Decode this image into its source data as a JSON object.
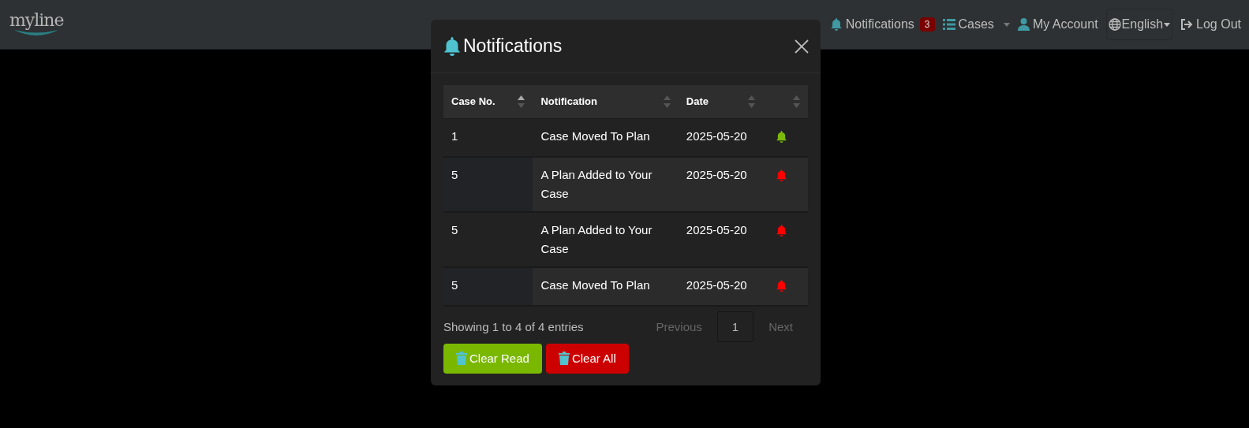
{
  "navbar": {
    "logo": "myline",
    "items": [
      {
        "kind": "notifications",
        "label": "Notifications",
        "badge": "3"
      },
      {
        "kind": "cases",
        "label": "Cases"
      },
      {
        "kind": "account",
        "label": "My Account"
      },
      {
        "kind": "language",
        "label": "English"
      },
      {
        "kind": "logout",
        "label": "Log Out"
      }
    ]
  },
  "modal": {
    "title": "Notifications",
    "table": {
      "columns": [
        {
          "label": "Case No.",
          "sorted": true
        },
        {
          "label": "Notification",
          "sorted": false
        },
        {
          "label": "Date",
          "sorted": false
        },
        {
          "sorted": false
        }
      ],
      "rows": [
        {
          "case_no": "1",
          "notification": "Case Moved To Plan",
          "date": "2025-05-20",
          "read": true
        },
        {
          "case_no": "5",
          "notification": "A Plan Added to Your Case",
          "date": "2025-05-20",
          "read": false
        },
        {
          "case_no": "5",
          "notification": "A Plan Added to Your Case",
          "date": "2025-05-20",
          "read": false
        },
        {
          "case_no": "5",
          "notification": "Case Moved To Plan",
          "date": "2025-05-20",
          "read": false
        }
      ]
    },
    "info": "Showing 1 to 4 of 4 entries",
    "pagination": [
      {
        "label": "Previous",
        "selected": false
      },
      {
        "label": "1",
        "selected": true
      },
      {
        "label": "Next",
        "selected": false
      }
    ],
    "buttons": [
      {
        "label": "Clear Read",
        "kind": "success"
      },
      {
        "label": "Clear All",
        "kind": "danger"
      }
    ]
  }
}
